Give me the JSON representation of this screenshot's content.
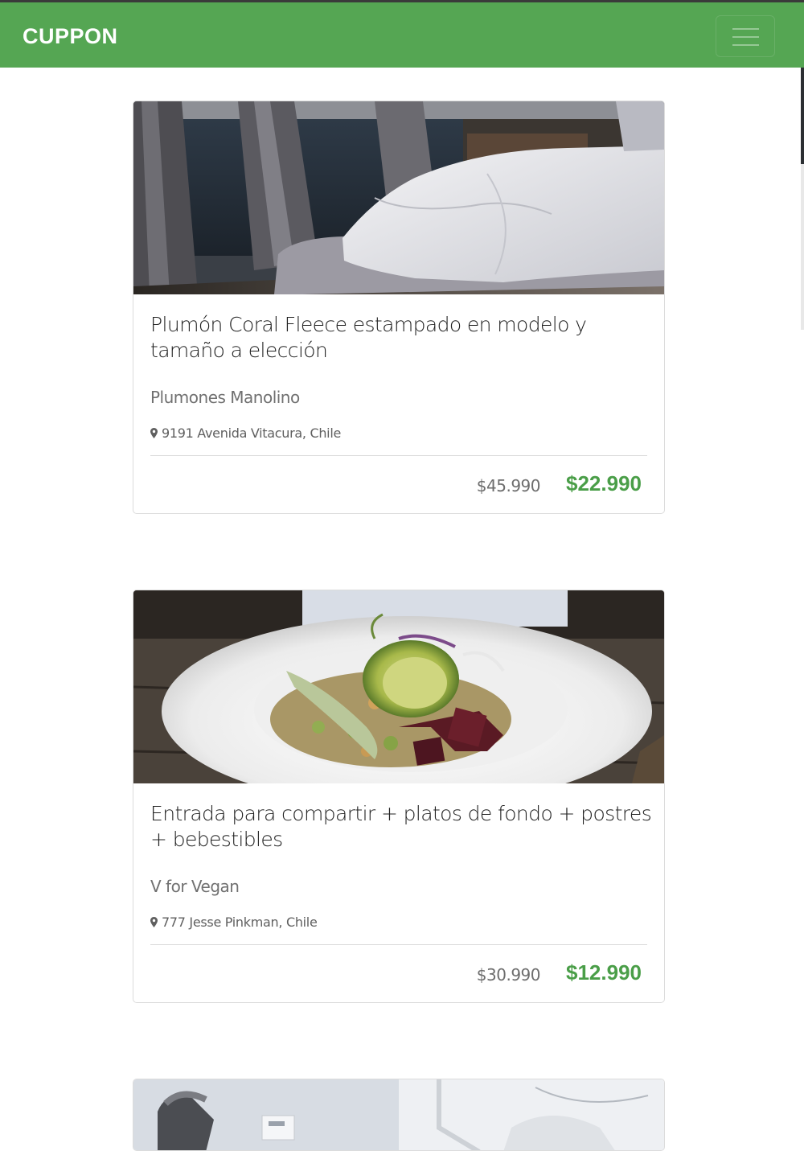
{
  "navbar": {
    "brand": "CUPPON",
    "menu_icon": "hamburger-menu-icon",
    "color": "#55a653"
  },
  "deals": [
    {
      "image": "bedroom-bed-photo",
      "title": "Plumón Coral Fleece estampado en modelo y tamaño a elección",
      "merchant": "Plumones Manolino",
      "location_icon": "map-pin-icon",
      "location": "9191 Avenida Vitacura, Chile",
      "old_price": "$45.990",
      "new_price": "$22.990"
    },
    {
      "image": "vegan-salad-bowl-photo",
      "title": "Entrada para compartir + platos de fondo + postres + bebestibles",
      "merchant": "V for Vegan",
      "location_icon": "map-pin-icon",
      "location": "777 Jesse Pinkman, Chile",
      "old_price": "$30.990",
      "new_price": "$12.990"
    },
    {
      "image": "dental-clinic-photo"
    }
  ],
  "colors": {
    "accent": "#55a653",
    "price": "#4a9e48"
  }
}
